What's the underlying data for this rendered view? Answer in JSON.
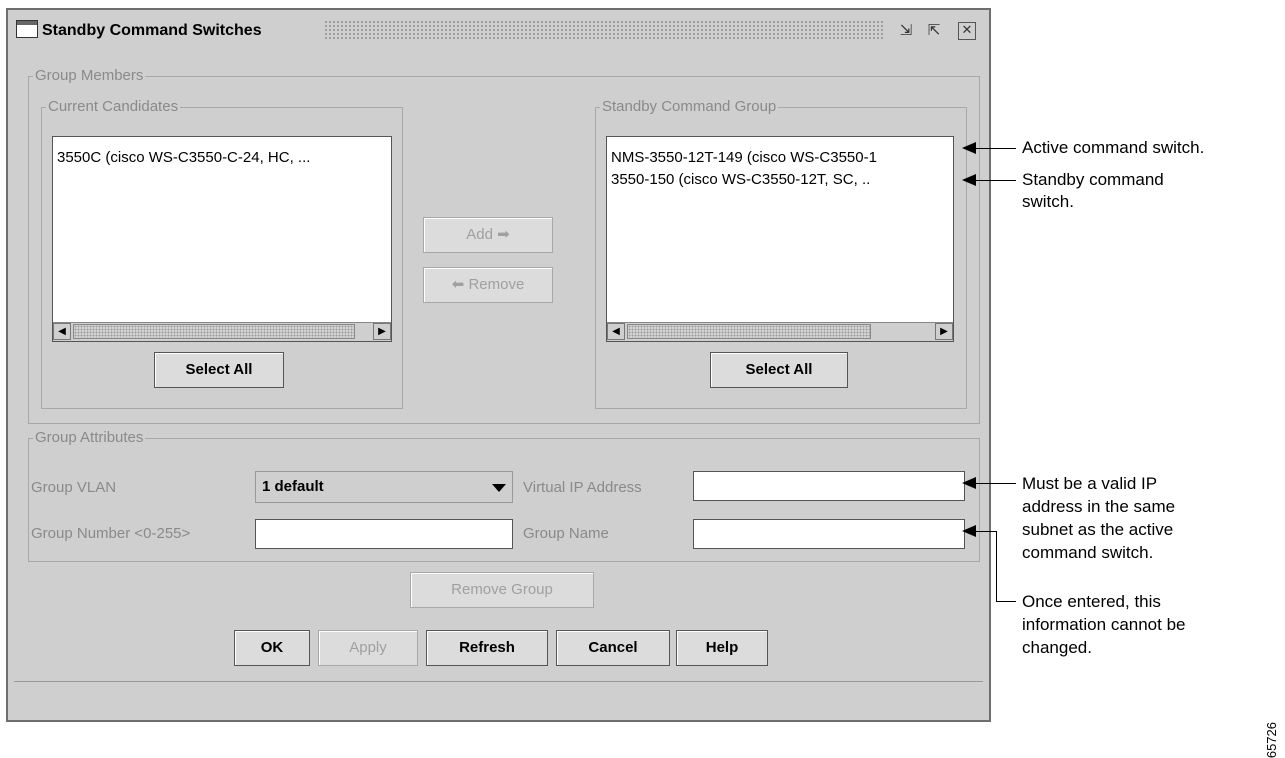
{
  "window": {
    "title": "Standby Command Switches",
    "controls": {
      "minimize_icon": "minimize-icon",
      "maximize_icon": "maximize-icon",
      "close_icon": "close-icon"
    }
  },
  "group_members": {
    "legend": "Group Members",
    "current_candidates": {
      "legend": "Current Candidates",
      "items": [
        "3550C (cisco WS-C3550-C-24, HC, ..."
      ],
      "select_all_label": "Select All"
    },
    "add_label": "Add",
    "remove_label": "Remove",
    "standby_group": {
      "legend": "Standby Command Group",
      "items": [
        "NMS-3550-12T-149 (cisco WS-C3550-1",
        "3550-150 (cisco WS-C3550-12T, SC, .."
      ],
      "select_all_label": "Select All"
    }
  },
  "group_attributes": {
    "legend": "Group Attributes",
    "vlan_label": "Group VLAN",
    "vlan_value": "1 default",
    "virtual_ip_label": "Virtual IP Address",
    "virtual_ip_value": "",
    "group_number_label": "Group Number <0-255>",
    "group_number_value": "",
    "group_name_label": "Group Name",
    "group_name_value": ""
  },
  "remove_group_label": "Remove Group",
  "footer_buttons": {
    "ok": "OK",
    "apply": "Apply",
    "refresh": "Refresh",
    "cancel": "Cancel",
    "help": "Help"
  },
  "callouts": {
    "active": "Active command switch.",
    "standby_line1": "Standby command",
    "standby_line2": "switch.",
    "ip_line1": "Must be a valid IP",
    "ip_line2": "address in the same",
    "ip_line3": "subnet as the active",
    "ip_line4": "command switch.",
    "once_line1": "Once entered, this",
    "once_line2": "information cannot be",
    "once_line3": "changed."
  },
  "figure_number": "65726"
}
